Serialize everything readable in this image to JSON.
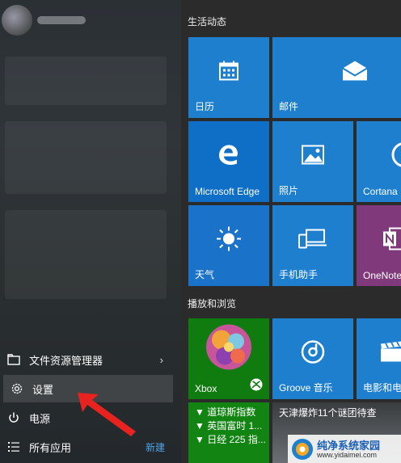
{
  "groups": {
    "life": "生活动态",
    "play": "播放和浏览"
  },
  "menu": {
    "explorer": "文件资源管理器",
    "settings": "设置",
    "power": "电源",
    "all_apps": "所有应用",
    "new": "新建",
    "arrow": "›"
  },
  "tiles": {
    "calendar": "日历",
    "mail": "邮件",
    "edge": "Microsoft Edge",
    "photos": "照片",
    "cortana": "Cortana",
    "weather": "天气",
    "phone": "手机助手",
    "onenote": "OneNote",
    "xbox": "Xbox",
    "groove": "Groove 音乐",
    "movies": "电影和电",
    "finance": [
      "▼ 道琼斯指数",
      "▼ 英国富时 1...",
      "▼ 日经 225 指..."
    ],
    "news": "天津爆炸11个谜团待查"
  },
  "watermark": {
    "site": "纯净系统家园",
    "url": "www.yidaimei.com"
  },
  "colors": {
    "tile_blue": "#1e7fcf",
    "xbox_green": "#107c10",
    "onenote_purple": "#80397b",
    "menu_accent": "#4fa3e8"
  }
}
